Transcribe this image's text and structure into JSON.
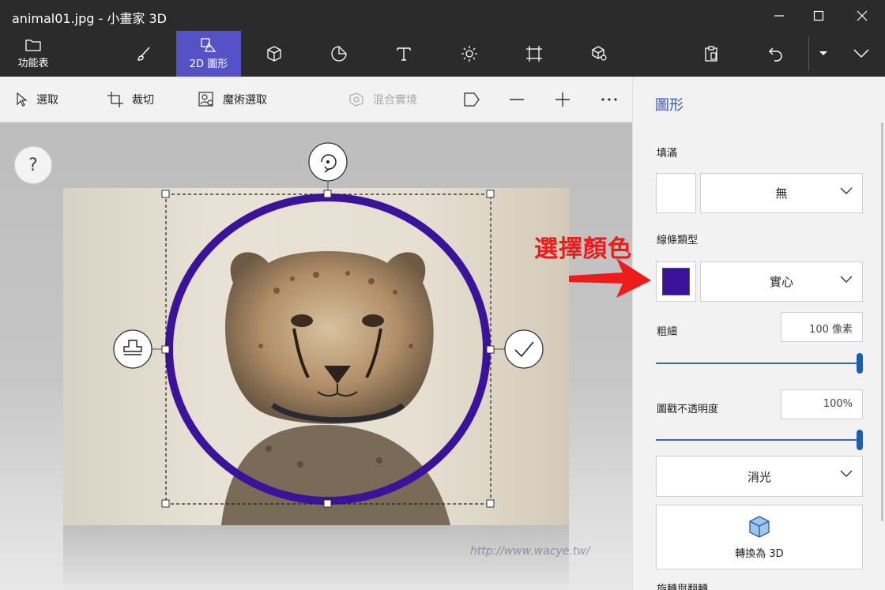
{
  "window": {
    "title": "animal01.jpg - 小畫家 3D"
  },
  "toolbar": {
    "menu_label": "功能表",
    "active_label": "2D 圖形"
  },
  "subbar": {
    "select": "選取",
    "crop": "裁切",
    "magic_select": "魔術選取",
    "mixed_reality": "混合實境"
  },
  "canvas": {
    "help": "?"
  },
  "panel": {
    "title": "圖形",
    "fill_label": "填滿",
    "fill_value": "無",
    "fill_color": "#ffffff",
    "line_type_label": "線條類型",
    "line_type_value": "實心",
    "line_color": "#3b129a",
    "thickness_label": "粗細",
    "thickness_value": "100 像素",
    "thickness_level": 1.0,
    "opacity_label": "圖戳不透明度",
    "opacity_value": "100%",
    "opacity_level": 1.0,
    "finish_value": "消光",
    "convert_3d": "轉換為 3D",
    "rotate_flip": "旋轉與翻轉"
  },
  "annotation": {
    "text": "選擇顏色"
  },
  "watermark": {
    "text": "http://www.wacye.tw/"
  },
  "colors": {
    "accent": "#5552c8",
    "shape_stroke": "#3b129a",
    "annotation": "#ee1b1b"
  }
}
